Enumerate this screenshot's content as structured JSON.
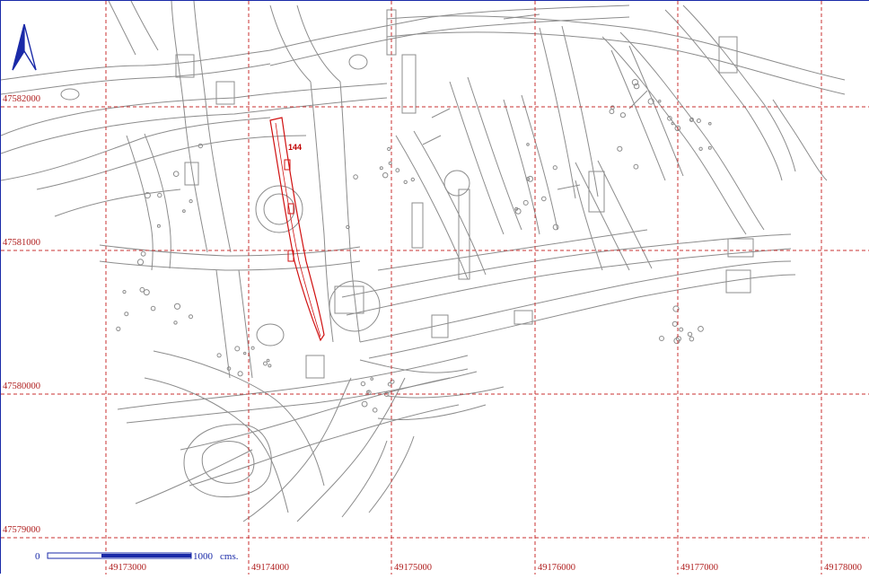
{
  "colors": {
    "grid": "#c83232",
    "features": "#8c8c8c",
    "highlight": "#d01010",
    "frame": "#1a2aa8",
    "scale": "#1a2aa8"
  },
  "grid": {
    "eastings": [
      "49173000",
      "49174000",
      "49175000",
      "49176000",
      "49177000",
      "49178000"
    ],
    "northings": [
      "47582000",
      "47581000",
      "47580000",
      "47579000"
    ]
  },
  "scale_bar": {
    "start_label": "0",
    "end_label": "1000",
    "unit_label": "cms."
  },
  "north_arrow": {
    "icon": "north-arrow-icon"
  },
  "highlight_feature": {
    "label": "144"
  }
}
